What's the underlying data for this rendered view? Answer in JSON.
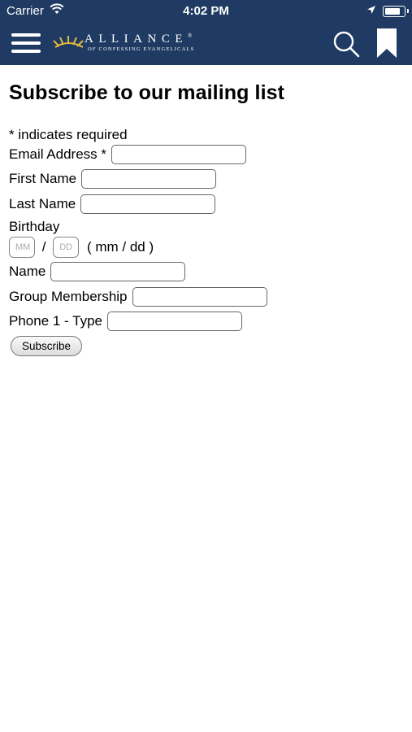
{
  "status_bar": {
    "carrier": "Carrier",
    "time": "4:02 PM"
  },
  "header": {
    "logo_main": "ALLIANCE",
    "logo_registered": "®",
    "logo_sub": "OF CONFESSING EVANGELICALS",
    "bg_color": "#1f3b63",
    "logo_accent": "#e6b73d"
  },
  "form": {
    "title": "Subscribe to our mailing list",
    "required_note": "* indicates required",
    "fields": {
      "email_label": "Email Address *",
      "first_name_label": "First Name",
      "last_name_label": "Last Name",
      "birthday_label": "Birthday",
      "birthday_month_placeholder": "MM",
      "birthday_sep": "/",
      "birthday_day_placeholder": "DD",
      "birthday_format": "( mm / dd )",
      "name_label": "Name",
      "group_label": "Group Membership",
      "phone_type_label": "Phone 1 - Type"
    },
    "submit_label": "Subscribe"
  }
}
